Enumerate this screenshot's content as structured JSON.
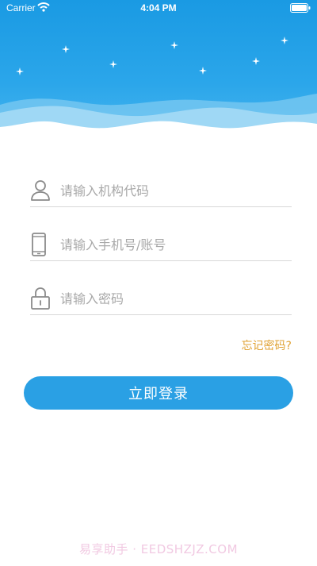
{
  "status_bar": {
    "carrier": "Carrier",
    "time": "4:04 PM",
    "icons": [
      "wifi-icon",
      "battery-icon"
    ]
  },
  "header": {
    "background": "#1a9ae3",
    "decoration": [
      "star-icon",
      "wave-decoration"
    ]
  },
  "form": {
    "org_code": {
      "placeholder": "请输入机构代码",
      "icon": "person-icon"
    },
    "phone_account": {
      "placeholder": "请输入手机号/账号",
      "icon": "phone-icon"
    },
    "password": {
      "placeholder": "请输入密码",
      "icon": "lock-icon"
    },
    "forgot_password": "忘记密码?",
    "login_button": "立即登录"
  },
  "colors": {
    "primary": "#2aa0e4",
    "link": "#e0a233",
    "placeholder": "#a8a8a8",
    "divider": "#d8d8d8"
  },
  "watermark": "易享助手 · EEDSHZJZ.COM"
}
